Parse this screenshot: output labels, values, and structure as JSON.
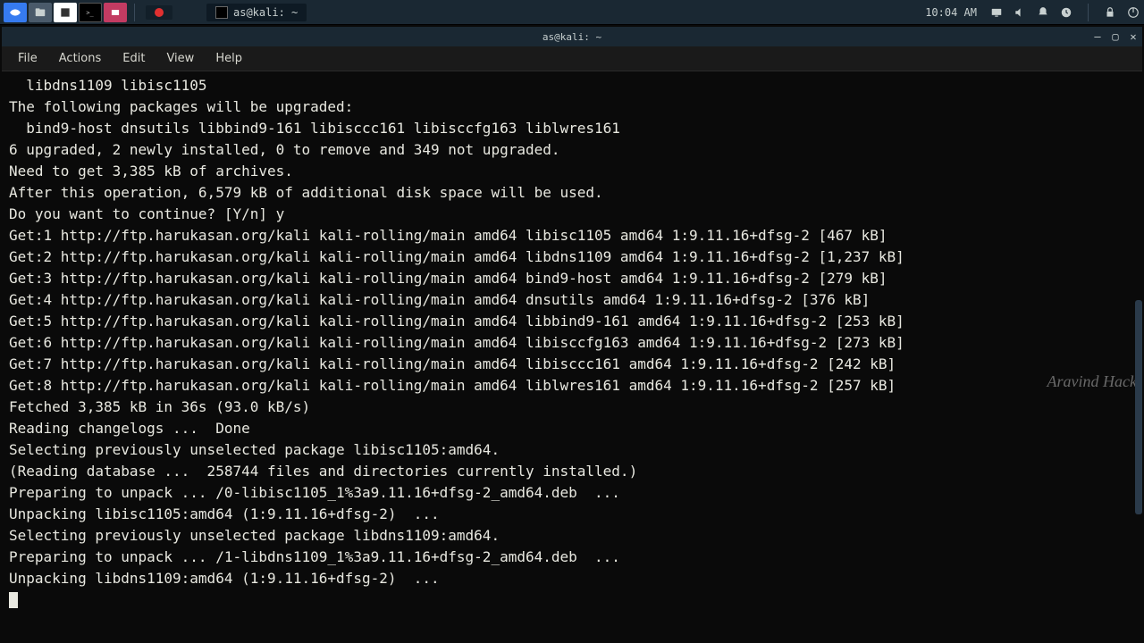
{
  "panel": {
    "taskbar_title": "as@kali: ~",
    "clock": "10:04 AM"
  },
  "window": {
    "title": "as@kali: ~"
  },
  "menubar": [
    "File",
    "Actions",
    "Edit",
    "View",
    "Help"
  ],
  "watermark": "Aravind Hack",
  "terminal_lines": [
    "  libdns1109 libisc1105",
    "The following packages will be upgraded:",
    "  bind9-host dnsutils libbind9-161 libisccc161 libisccfg163 liblwres161",
    "6 upgraded, 2 newly installed, 0 to remove and 349 not upgraded.",
    "Need to get 3,385 kB of archives.",
    "After this operation, 6,579 kB of additional disk space will be used.",
    "Do you want to continue? [Y/n] y",
    "Get:1 http://ftp.harukasan.org/kali kali-rolling/main amd64 libisc1105 amd64 1:9.11.16+dfsg-2 [467 kB]",
    "Get:2 http://ftp.harukasan.org/kali kali-rolling/main amd64 libdns1109 amd64 1:9.11.16+dfsg-2 [1,237 kB]",
    "Get:3 http://ftp.harukasan.org/kali kali-rolling/main amd64 bind9-host amd64 1:9.11.16+dfsg-2 [279 kB]",
    "Get:4 http://ftp.harukasan.org/kali kali-rolling/main amd64 dnsutils amd64 1:9.11.16+dfsg-2 [376 kB]",
    "Get:5 http://ftp.harukasan.org/kali kali-rolling/main amd64 libbind9-161 amd64 1:9.11.16+dfsg-2 [253 kB]",
    "Get:6 http://ftp.harukasan.org/kali kali-rolling/main amd64 libisccfg163 amd64 1:9.11.16+dfsg-2 [273 kB]",
    "Get:7 http://ftp.harukasan.org/kali kali-rolling/main amd64 libisccc161 amd64 1:9.11.16+dfsg-2 [242 kB]",
    "Get:8 http://ftp.harukasan.org/kali kali-rolling/main amd64 liblwres161 amd64 1:9.11.16+dfsg-2 [257 kB]",
    "Fetched 3,385 kB in 36s (93.0 kB/s)",
    "Reading changelogs ...  Done",
    "Selecting previously unselected package libisc1105:amd64.",
    "(Reading database ...  258744 files and directories currently installed.)",
    "Preparing to unpack ... /0-libisc1105_1%3a9.11.16+dfsg-2_amd64.deb  ...",
    "Unpacking libisc1105:amd64 (1:9.11.16+dfsg-2)  ...",
    "Selecting previously unselected package libdns1109:amd64.",
    "Preparing to unpack ... /1-libdns1109_1%3a9.11.16+dfsg-2_amd64.deb  ...",
    "Unpacking libdns1109:amd64 (1:9.11.16+dfsg-2)  ..."
  ]
}
